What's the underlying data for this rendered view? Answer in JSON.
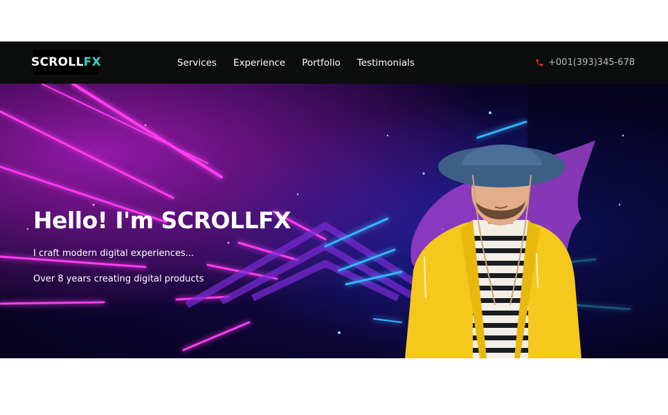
{
  "header": {
    "logo": {
      "part1": "SCROLL",
      "part2": "FX"
    },
    "nav": [
      "Services",
      "Experience",
      "Portfolio",
      "Testimonials"
    ],
    "phone": "+001(393)345-678"
  },
  "hero": {
    "title": "Hello! I'm SCROLLFX",
    "subtitle": "I craft modern digital experiences...",
    "tagline": "Over 8 years creating digital products"
  },
  "colors": {
    "accent": "#3ad0c8",
    "navbar": "#0c0d0d",
    "neon_pink": "#ff2fe0",
    "neon_blue": "#2aa7ff",
    "phone_icon": "#e8322a",
    "raincoat": "#f4c81c"
  },
  "icons": {
    "phone": "phone-icon"
  }
}
